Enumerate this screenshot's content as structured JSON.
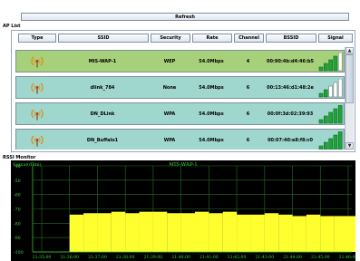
{
  "toolbar": {
    "refresh_label": "Refresh"
  },
  "ap_list": {
    "title": "AP List",
    "columns": [
      "Type",
      "SSID",
      "Security",
      "Rate",
      "Channel",
      "BSSID",
      "Signal"
    ],
    "rows": [
      {
        "ssid": "MIS-WAP-1",
        "security": "WEP",
        "rate": "54.0Mbps",
        "channel": "4",
        "bssid": "00:90:4b:d4:46:b5",
        "signal_bars": 4,
        "selected": true
      },
      {
        "ssid": "dlink_784",
        "security": "None",
        "rate": "54.0Mbps",
        "channel": "6",
        "bssid": "00:13:46:d1:48:2e",
        "signal_bars": 2,
        "selected": false
      },
      {
        "ssid": "DN_DLink",
        "security": "WPA",
        "rate": "54.0Mbps",
        "channel": "6",
        "bssid": "00:0f:3d:02:39:93",
        "signal_bars": 5,
        "selected": false
      },
      {
        "ssid": "DN_Buffalo1",
        "security": "WPA",
        "rate": "54.0Mbps",
        "channel": "6",
        "bssid": "00:07:40:e8:f8:c0",
        "signal_bars": 5,
        "selected": false
      }
    ],
    "type_icon": "wireless-ap-icon"
  },
  "rssi": {
    "title": "RSSI Monitor",
    "chart_data": {
      "type": "bar",
      "title": "MIS-WAP-1",
      "ylabel": "Signal(dBm)",
      "ylim": [
        -100,
        -40
      ],
      "yticks": [
        -40,
        -50,
        -60,
        -70,
        -80,
        -90,
        -100
      ],
      "xticks": [
        "21:35:00",
        "21:36:00",
        "21:37:00",
        "21:38:00",
        "21:39:00",
        "21:40:00",
        "21:41:00",
        "21:42:00",
        "21:43:00",
        "21:44:00",
        "21:45:00",
        "21:46:00"
      ],
      "series": [
        {
          "color": "#ffff30",
          "x": [
            "21:35:00",
            "21:35:30",
            "21:36:00",
            "21:36:30",
            "21:37:00",
            "21:37:30",
            "21:38:00",
            "21:38:30",
            "21:39:00",
            "21:39:30",
            "21:40:00",
            "21:40:30",
            "21:41:00",
            "21:41:30",
            "21:42:00",
            "21:42:30",
            "21:43:00",
            "21:43:30",
            "21:44:00",
            "21:44:30",
            "21:45:00",
            "21:45:30",
            "21:46:00",
            "21:46:30"
          ],
          "values": [
            -100,
            -100,
            -74,
            -73,
            -73,
            -72,
            -73,
            -72,
            -72,
            -73,
            -73,
            -72,
            -73,
            -72,
            -74,
            -74,
            -73,
            -74,
            -75,
            -74,
            -75,
            -75,
            -75,
            -75
          ]
        }
      ],
      "grid": true
    },
    "colors": {
      "background": "#000000",
      "grid": "#2a6e2a",
      "axis_text": "#39d839",
      "title_text": "#39d839",
      "bars": "#ffff30"
    }
  },
  "colors": {
    "selected_row": "#a6d17a",
    "row": "#9fd7cf",
    "signal_on": "#1fa33a"
  }
}
